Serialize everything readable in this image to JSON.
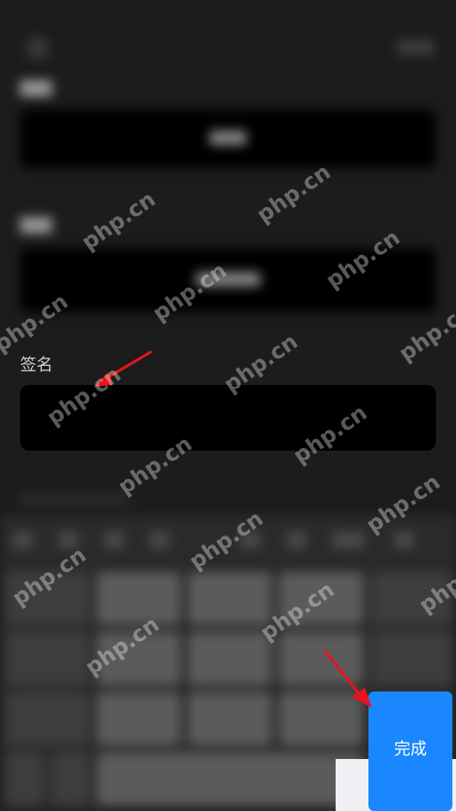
{
  "signature": {
    "label": "签名",
    "value": ""
  },
  "keyboard": {
    "done_label": "完成"
  },
  "watermark": "php.cn",
  "colors": {
    "accent": "#1a87ff",
    "arrow": "#e8141d"
  }
}
